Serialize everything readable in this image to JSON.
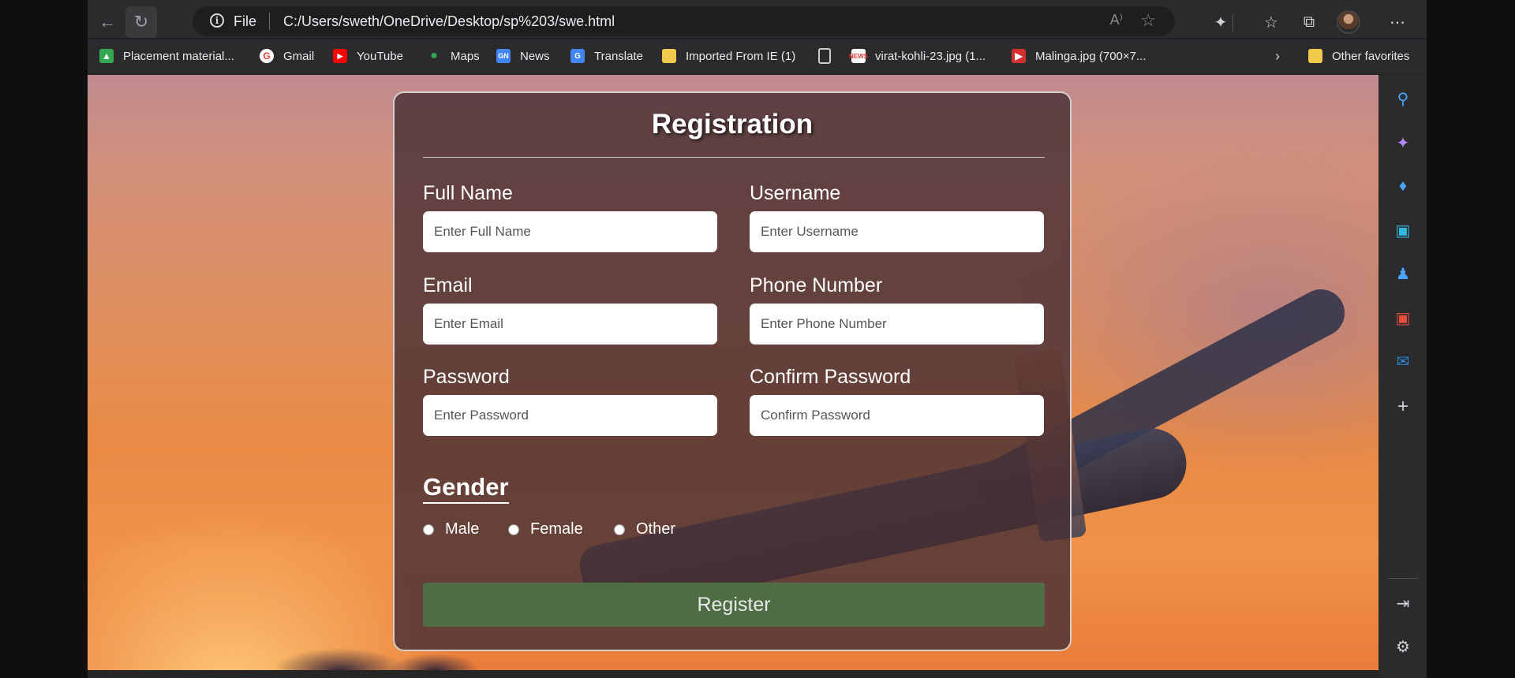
{
  "browser": {
    "address": {
      "scheme_label": "File",
      "url": "C:/Users/sweth/OneDrive/Desktop/sp%203/swe.html"
    },
    "bookmarks": [
      {
        "label": "Placement material...",
        "icon": "drive-icon",
        "color": "#34a853"
      },
      {
        "label": "Gmail",
        "icon": "google-icon",
        "color": "#ea4335"
      },
      {
        "label": "YouTube",
        "icon": "youtube-icon",
        "color": "#ff0000"
      },
      {
        "label": "Maps",
        "icon": "maps-icon",
        "color": "#34a853"
      },
      {
        "label": "News",
        "icon": "news-icon",
        "color": "#4285f4"
      },
      {
        "label": "Translate",
        "icon": "translate-icon",
        "color": "#4285f4"
      },
      {
        "label": "Imported From IE (1)",
        "icon": "folder-icon",
        "color": "#f2c94c"
      },
      {
        "label": "",
        "icon": "page-icon",
        "color": "#cccccc"
      },
      {
        "label": "virat-kohli-23.jpg (1...",
        "icon": "news-site-icon",
        "color": "#e53935"
      },
      {
        "label": "Malinga.jpg (700×7...",
        "icon": "image-site-icon",
        "color": "#d32f2f"
      }
    ],
    "other_favorites": "Other favorites"
  },
  "form": {
    "title": "Registration",
    "fields": {
      "full_name": {
        "label": "Full Name",
        "placeholder": "Enter Full Name"
      },
      "username": {
        "label": "Username",
        "placeholder": "Enter Username"
      },
      "email": {
        "label": "Email",
        "placeholder": "Enter Email"
      },
      "phone": {
        "label": "Phone Number",
        "placeholder": "Enter Phone Number"
      },
      "password": {
        "label": "Password",
        "placeholder": "Enter Password"
      },
      "confirm_password": {
        "label": "Confirm Password",
        "placeholder": "Confirm Password"
      }
    },
    "gender": {
      "title": "Gender",
      "options": [
        "Male",
        "Female",
        "Other"
      ]
    },
    "submit_label": "Register",
    "colors": {
      "button": "#4f6d45",
      "card": "#48303",
      "accent": "#ffffff"
    }
  }
}
